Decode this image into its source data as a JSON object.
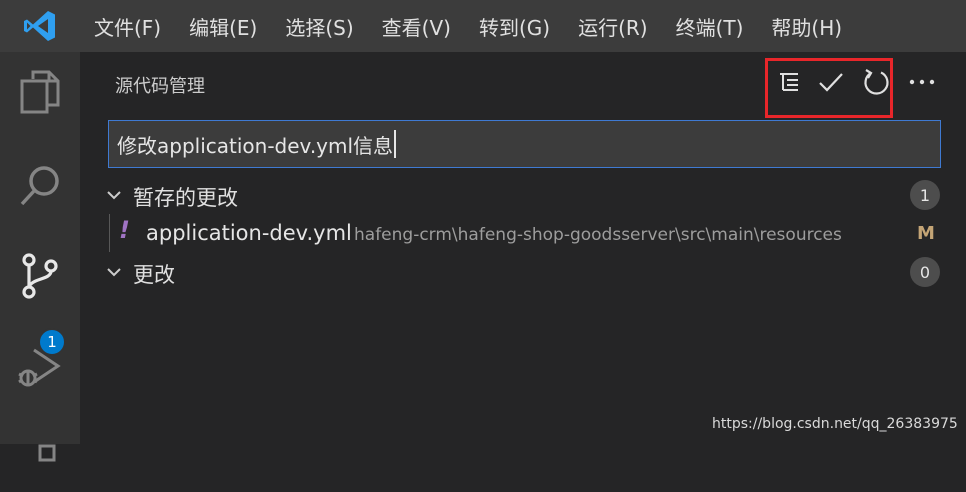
{
  "menubar": {
    "items": [
      "文件(F)",
      "编辑(E)",
      "选择(S)",
      "查看(V)",
      "转到(G)",
      "运行(R)",
      "终端(T)",
      "帮助(H)"
    ]
  },
  "activitybar": {
    "icons": [
      "files-icon",
      "search-icon",
      "source-control-icon",
      "run-debug-icon",
      "extensions-icon"
    ],
    "scm_badge": "1",
    "badge_color": "#007acc"
  },
  "scm": {
    "title": "源代码管理",
    "actions": [
      "view-as-tree-icon",
      "commit-check-icon",
      "refresh-icon",
      "more-actions-icon"
    ],
    "commit_message": "修改application-dev.yml信息",
    "staged": {
      "label": "暂存的更改",
      "count": "1",
      "files": [
        {
          "icon": "!",
          "name": "application-dev.yml",
          "path": "hafeng-crm\\hafeng-shop-goodsserver\\src\\main\\resources",
          "status": "M"
        }
      ]
    },
    "changes": {
      "label": "更改",
      "count": "0"
    },
    "highlight_color": "#e8262a"
  },
  "watermark": "https://blog.csdn.net/qq_26383975"
}
